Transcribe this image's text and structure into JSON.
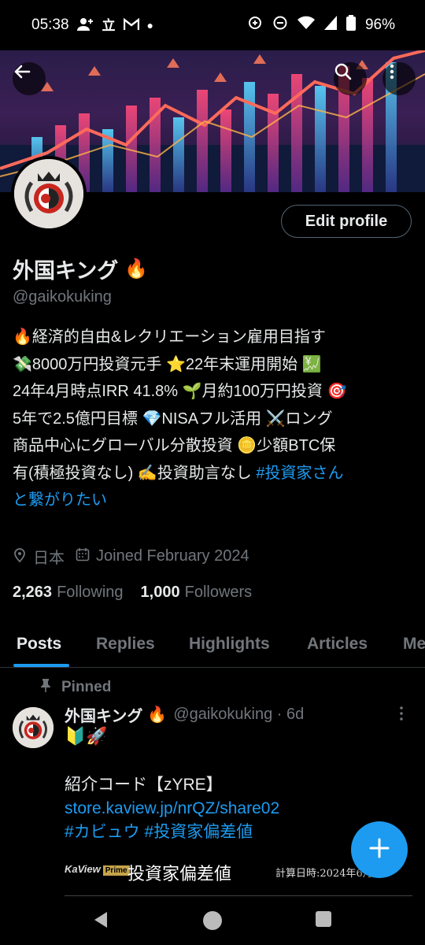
{
  "status_bar": {
    "time": "05:38",
    "battery": "96%",
    "left_icons": [
      "person-add-icon",
      "kanji-icon",
      "gmail-icon",
      "dot-icon"
    ],
    "right_icons": [
      "sync-icon",
      "dnd-icon",
      "wifi-icon",
      "signal-icon",
      "battery-icon"
    ]
  },
  "header": {
    "back_icon": "arrow-left-icon",
    "search_icon": "search-icon",
    "more_icon": "more-vertical-icon"
  },
  "profile": {
    "edit_profile_label": "Edit profile",
    "display_name": "外国キング",
    "name_emoji": "🔥",
    "handle": "@gaikokuking",
    "bio_lines": [
      "🔥経済的自由&レクリエーション雇用目指す",
      "💸8000万円投資元手 ⭐22年末運用開始 💹",
      "24年4月時点IRR 41.8% 🌱月約100万円投資 🎯",
      "5年で2.5億円目標 💎NISAフル活用 ⚔️ロング",
      "商品中心にグローバル分散投資 🪙少額BTC保"
    ],
    "bio_line6_text": "有(積極投資なし) ✍️投資助言なし ",
    "bio_line6_tag": "#投資家さん",
    "bio_line7_tag": "と繋がりたい",
    "location": "日本",
    "joined": "Joined February 2024",
    "following_count": "2,263",
    "following_label": "Following",
    "followers_count": "1,000",
    "followers_label": "Followers"
  },
  "tabs": [
    {
      "label": "Posts",
      "active": true
    },
    {
      "label": "Replies",
      "active": false
    },
    {
      "label": "Highlights",
      "active": false
    },
    {
      "label": "Articles",
      "active": false
    },
    {
      "label": "Me",
      "active": false
    }
  ],
  "post": {
    "pinned_label": "Pinned",
    "author_name": "外国キング",
    "author_emoji": "🔥",
    "author_handle": "@gaikokuking · 6d",
    "emojis": "🔰🚀",
    "line1": "紹介コード【zYRE】",
    "link": "store.kaview.jp/nrQZ/share02",
    "hashtags": "#カビュウ #投資家偏差値",
    "card": {
      "brand": "KaView",
      "brand_badge": "Prime",
      "title": "投資家偏差値",
      "date": "計算日時:2024年6月…6"
    }
  },
  "fab": {
    "icon": "plus-icon"
  },
  "nav_bar": {
    "icons": [
      "back-triangle-icon",
      "home-circle-icon",
      "recents-square-icon"
    ]
  },
  "colors": {
    "accent": "#1d9bf0",
    "text": "#e7e9ea",
    "muted": "#71767b",
    "border": "#2f3336",
    "background": "#000000"
  }
}
